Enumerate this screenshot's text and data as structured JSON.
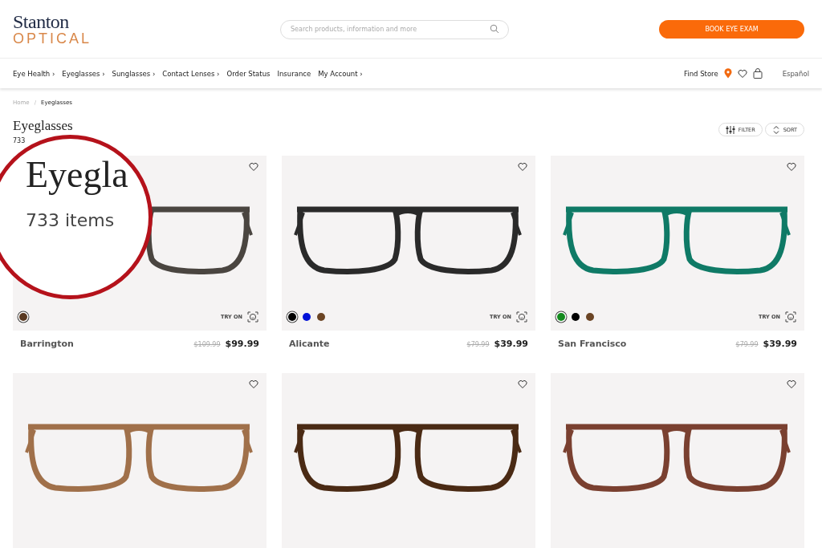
{
  "header": {
    "logo": {
      "top": "Stanton",
      "bottom": "OPTICAL"
    },
    "search": {
      "placeholder": "Search products, information and more"
    },
    "cta": "BOOK EYE EXAM"
  },
  "nav": {
    "items": [
      {
        "label": "Eye Health ›"
      },
      {
        "label": "Eyeglasses ›"
      },
      {
        "label": "Sunglasses ›"
      },
      {
        "label": "Contact Lenses ›"
      },
      {
        "label": "Order Status"
      },
      {
        "label": "Insurance"
      },
      {
        "label": "My Account ›"
      }
    ],
    "find_store": "Find Store",
    "language": "Español"
  },
  "breadcrumb": {
    "items": [
      "Home",
      "Eyeglasses"
    ],
    "separator": "/"
  },
  "page": {
    "title": "Eyeglasses",
    "count": "733",
    "actions": [
      "FILTER",
      "SORT"
    ]
  },
  "magnifier": {
    "title": "Eyegla",
    "count": "733 items"
  },
  "products": [
    {
      "name": "Barrington",
      "old_price": "$109.99",
      "price": "$99.99",
      "color": "#4a4540",
      "try_on": "TRY ON",
      "swatches": [
        {
          "color": "#5a3a22",
          "selected": true
        }
      ]
    },
    {
      "name": "Alicante",
      "old_price": "$79.99",
      "price": "$39.99",
      "color": "#2a2a2a",
      "try_on": "TRY ON",
      "swatches": [
        {
          "color": "#000000",
          "selected": true
        },
        {
          "color": "#0010d8",
          "selected": false
        },
        {
          "color": "#6b4424",
          "selected": false
        }
      ]
    },
    {
      "name": "San Francisco",
      "old_price": "$79.99",
      "price": "$39.99",
      "color": "#0f7a66",
      "try_on": "TRY ON",
      "swatches": [
        {
          "color": "#138a1e",
          "selected": true
        },
        {
          "color": "#000000",
          "selected": false
        },
        {
          "color": "#6b4424",
          "selected": false
        }
      ]
    },
    {
      "color": "#a0704a"
    },
    {
      "color": "#4a2a14"
    },
    {
      "color": "#7a4030"
    }
  ]
}
